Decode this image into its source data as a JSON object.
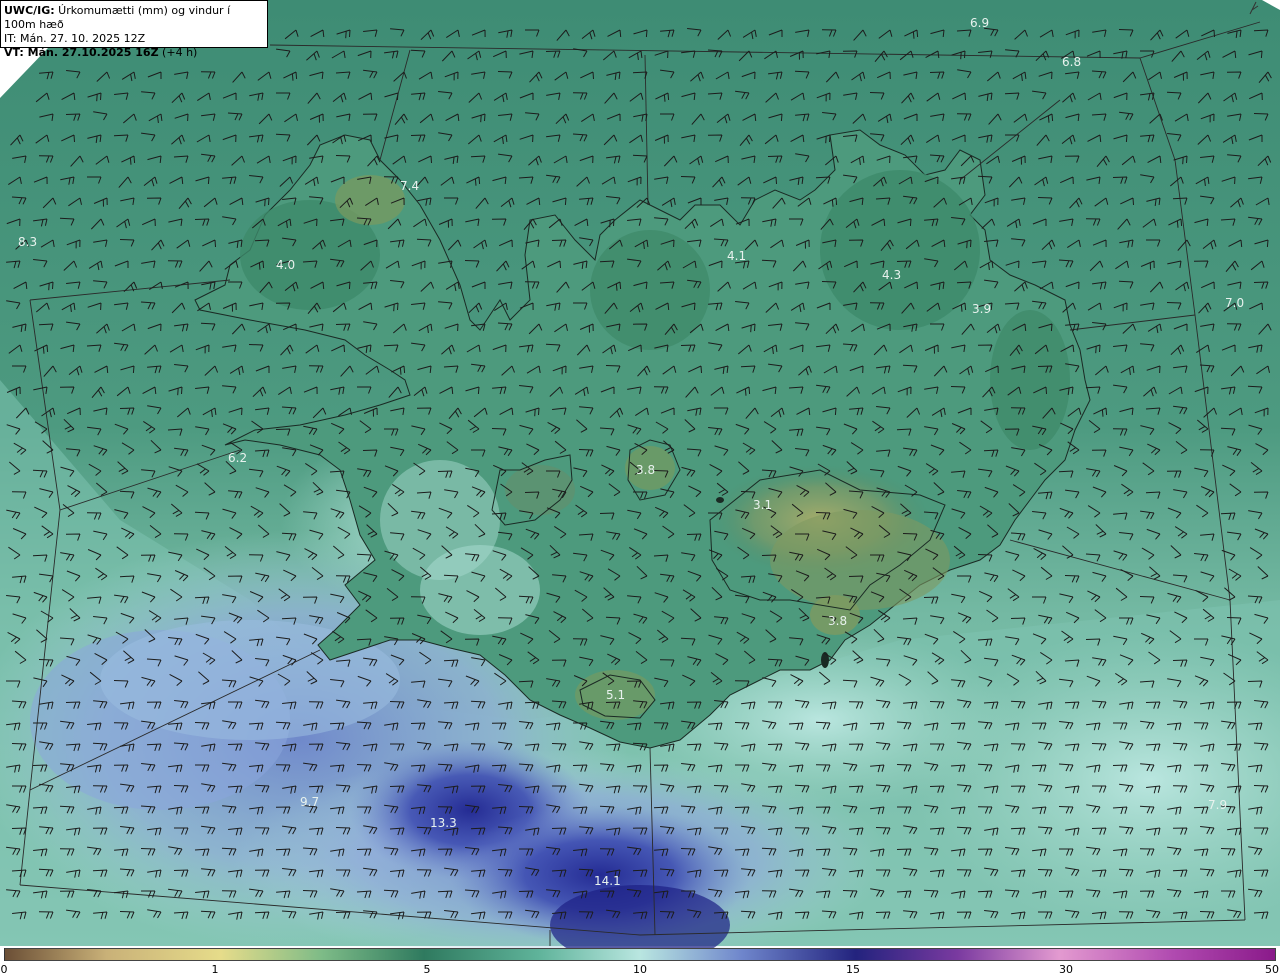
{
  "header": {
    "product_prefix": "UWC/IG:",
    "product_title": " Úrkomumætti (mm) og vindur í 100m hæð",
    "init_time": "IT: Mán. 27. 10. 2025 12Z",
    "valid_prefix": "VT: Mán. 27.10.2025 16Z",
    "valid_suffix": " (+4 h)"
  },
  "map_labels": [
    {
      "id": "wf",
      "text": "4.0"
    },
    {
      "id": "nw",
      "text": "7.4"
    },
    {
      "id": "w_sea",
      "text": "8.3"
    },
    {
      "id": "n1",
      "text": "6.9"
    },
    {
      "id": "n2",
      "text": "6.8"
    },
    {
      "id": "nc",
      "text": "4.1"
    },
    {
      "id": "ne",
      "text": "4.3"
    },
    {
      "id": "e1",
      "text": "3.9"
    },
    {
      "id": "e_sea",
      "text": "7.0"
    },
    {
      "id": "w2",
      "text": "6.2"
    },
    {
      "id": "c",
      "text": "3.8"
    },
    {
      "id": "vj",
      "text": "3.1"
    },
    {
      "id": "se",
      "text": "3.8"
    },
    {
      "id": "s",
      "text": "5.1"
    },
    {
      "id": "sw",
      "text": "9.7"
    },
    {
      "id": "s1",
      "text": "13.3"
    },
    {
      "id": "s2",
      "text": "14.1"
    },
    {
      "id": "se_sea",
      "text": "7.9"
    }
  ],
  "colorbar": {
    "ticks": [
      "0",
      "1",
      "5",
      "10",
      "15",
      "30",
      "50"
    ],
    "colors": [
      "#6b4f36",
      "#c9b178",
      "#e6dc8a",
      "#7dbb87",
      "#2f7a5f",
      "#5fb39a",
      "#b9e6e0",
      "#6f86cc",
      "#23237e",
      "#7a3aa0",
      "#e39ad0",
      "#b04ab0",
      "#8a1a8a"
    ]
  }
}
